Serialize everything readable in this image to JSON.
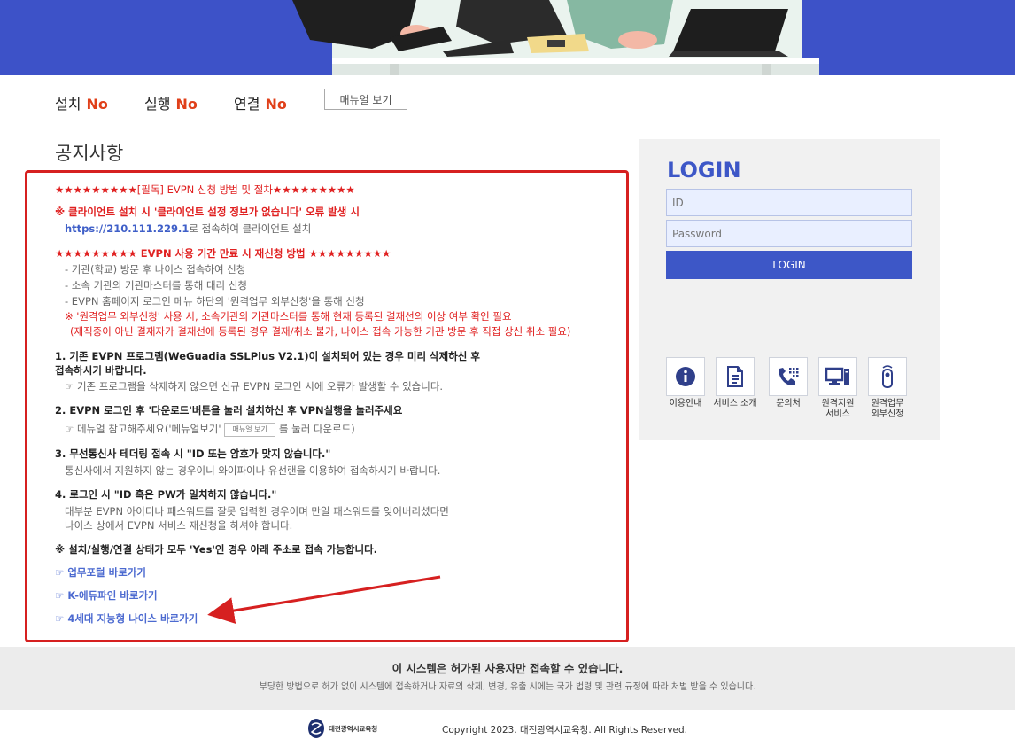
{
  "status": {
    "install_label": "설치",
    "install_value": "No",
    "run_label": "실행",
    "run_value": "No",
    "connect_label": "연결",
    "connect_value": "No",
    "manual_button": "매뉴얼 보기"
  },
  "notice": {
    "title": "공지사항",
    "headline": "★★★★★★★★★[필독] EVPN 신청 방법 및 절차★★★★★★★★★",
    "error_note": "※ 클라이언트 설치 시 '클라이언트 설정 정보가 없습니다' 오류 발생 시",
    "url_text": "https://210.111.229.1",
    "url_suffix": "로 접속하여 클라이언트 설치",
    "renew_heading": "★★★★★★★★★ EVPN 사용 기간 만료 시 재신청 방법 ★★★★★★★★★",
    "renew_items": [
      "- 기관(학교) 방문 후 나이스 접속하여 신청",
      "- 소속 기관의 기관마스터를 통해 대리 신청",
      "- EVPN 홈페이지 로그인 메뉴 하단의 '원격업무 외부신청'을 통해 신청"
    ],
    "warn_1": "※ '원격업무 외부신청' 사용 시, 소속기관의 기관마스터를 통해 현재 등록된 결재선의 이상 여부 확인 필요",
    "warn_2": "(재직중이 아닌 결재자가 결재선에 등록된 경우 결재/취소 불가, 나이스 접속 가능한 기관 방문 후 직접 상신 취소 필요)",
    "item1_line1": "1. 기존 EVPN 프로그램(WeGuadia SSLPlus V2.1)이 설치되어 있는 경우 미리 삭제하신 후",
    "item1_line2": "접속하시기 바랍니다.",
    "item1_sub": "☞ 기존 프로그램을 삭제하지 않으면 신규 EVPN 로그인 시에 오류가 발생할 수 있습니다.",
    "item2": "2. EVPN 로그인 후 '다운로드'버튼을 눌러 설치하신 후 VPN실행을 눌러주세요",
    "item2_sub_prefix": "☞ 메뉴얼 참고해주세요('메뉴얼보기'",
    "item2_sub_button": "매뉴얼 보기",
    "item2_sub_suffix": "를 눌러 다운로드)",
    "item3": "3. 무선통신사 테더링 접속 시 \"ID 또는 암호가 맞지 않습니다.\"",
    "item3_sub": "통신사에서 지원하지 않는 경우이니 와이파이나 유선랜을 이용하여 접속하시기 바랍니다.",
    "item4": "4. 로그인 시 \"ID 혹은 PW가 일치하지 않습니다.\"",
    "item4_sub1": "대부분 EVPN 아이디나 패스워드를 잘못 입력한 경우이며 만일 패스워드를 잊어버리셨다면",
    "item4_sub2": "나이스 상에서 EVPN 서비스 재신청을 하셔야 합니다.",
    "all_yes_note": "※ 설치/실행/연결 상태가 모두 'Yes'인 경우 아래 주소로 접속 가능합니다.",
    "links": [
      "☞ 업무포털 바로가기",
      "☞ K-에듀파인 바로가기",
      "☞ 4세대 지능형 나이스 바로가기"
    ]
  },
  "login": {
    "title": "LOGIN",
    "id_placeholder": "ID",
    "password_placeholder": "Password",
    "button": "LOGIN"
  },
  "services": [
    {
      "label": "이용안내",
      "icon": "info-icon"
    },
    {
      "label": "서비스 소개",
      "icon": "document-icon"
    },
    {
      "label": "문의처",
      "icon": "phone-icon"
    },
    {
      "label": "원격지원\n서비스",
      "icon": "monitor-icon"
    },
    {
      "label": "원격업무\n외부신청",
      "icon": "remote-icon"
    }
  ],
  "footer": {
    "warning_title": "이 시스템은 허가된 사용자만 접속할 수 있습니다.",
    "warning_text": "부당한 방법으로 허가 없이 시스템에 접속하거나 자료의 삭제, 변경, 유출 시에는 국가 법령 및 관련 규정에 따라 처벌 받을 수 있습니다.",
    "logo_text": "대전광역시교육청",
    "copyright": "Copyright 2023. 대전광역시교육청. All Rights Reserved."
  },
  "colors": {
    "accent": "#3d57c7",
    "status_no": "#e0401a",
    "notice_red": "#e02020",
    "annotation_red": "#d62020"
  }
}
